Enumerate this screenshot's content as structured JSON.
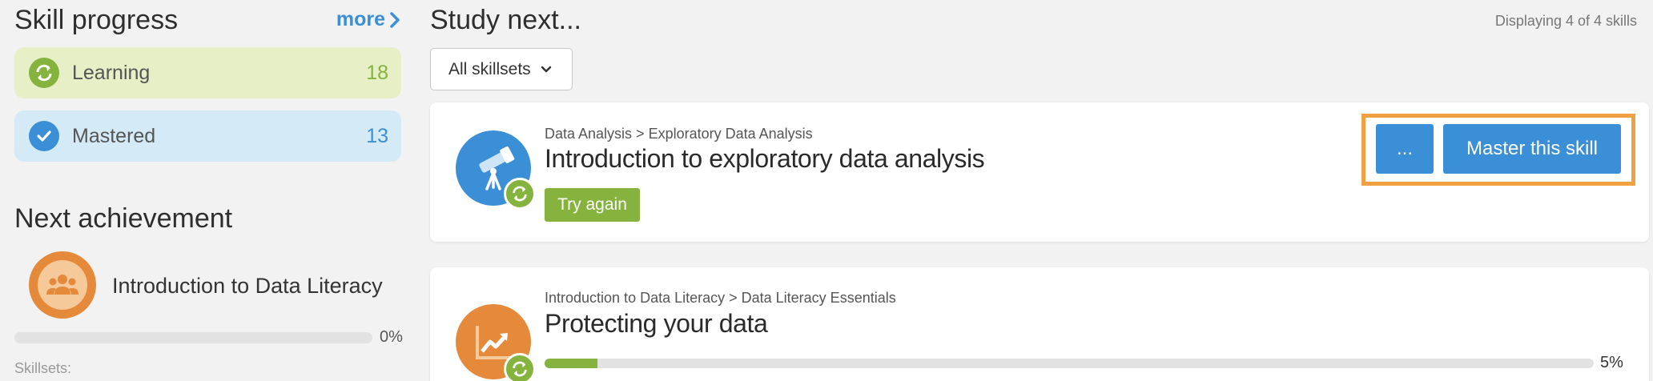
{
  "skill_progress": {
    "title": "Skill progress",
    "more_label": "more",
    "learning": {
      "label": "Learning",
      "count": "18"
    },
    "mastered": {
      "label": "Mastered",
      "count": "13"
    }
  },
  "next_achievement": {
    "title": "Next achievement",
    "name": "Introduction to Data Literacy",
    "progress_label": "0%",
    "progress": 0,
    "skillsets_label": "Skillsets:"
  },
  "study_next": {
    "title": "Study next...",
    "displaying": "Displaying 4 of 4 skills",
    "filter_value": "All skillsets"
  },
  "cards": [
    {
      "breadcrumb": "Data Analysis > Exploratory Data Analysis",
      "title": "Introduction to exploratory data analysis",
      "try_again_label": "Try again",
      "more_label": "...",
      "master_label": "Master this skill"
    },
    {
      "breadcrumb": "Introduction to Data Literacy > Data Literacy Essentials",
      "title": "Protecting your data",
      "progress_label": "5%",
      "progress": 5
    }
  ],
  "colors": {
    "accent_blue": "#3b8fd6",
    "accent_green": "#86b33d",
    "accent_orange": "#e5893a",
    "highlight": "#f0a040"
  }
}
